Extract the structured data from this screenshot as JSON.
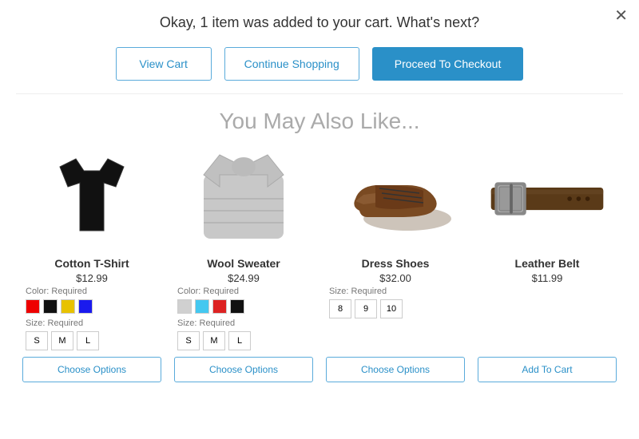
{
  "header": {
    "message": "Okay, 1 item was added to your cart. What's next?",
    "close_label": "✕"
  },
  "actions": {
    "view_cart": "View Cart",
    "continue_shopping": "Continue Shopping",
    "proceed_checkout": "Proceed To Checkout"
  },
  "section_title": "You May Also Like...",
  "products": [
    {
      "id": "tshirt",
      "name": "Cotton T-Shirt",
      "price": "$12.99",
      "color_label": "Color: Required",
      "colors": [
        "#e00",
        "#111",
        "#e8c200",
        "#1a1aee"
      ],
      "size_label": "Size: Required",
      "sizes": [
        "S",
        "M",
        "L"
      ],
      "cta": "Choose Options",
      "cta_type": "choose"
    },
    {
      "id": "sweater",
      "name": "Wool Sweater",
      "price": "$24.99",
      "color_label": "Color: Required",
      "colors": [
        "#d0d0d0",
        "#44c8f0",
        "#dd2222",
        "#111"
      ],
      "size_label": "Size: Required",
      "sizes": [
        "S",
        "M",
        "L"
      ],
      "cta": "Choose Options",
      "cta_type": "choose"
    },
    {
      "id": "shoes",
      "name": "Dress Shoes",
      "price": "$32.00",
      "color_label": null,
      "colors": [],
      "size_label": "Size: Required",
      "sizes": [
        "8",
        "9",
        "10"
      ],
      "cta": "Choose Options",
      "cta_type": "choose"
    },
    {
      "id": "belt",
      "name": "Leather Belt",
      "price": "$11.99",
      "color_label": null,
      "colors": [],
      "size_label": null,
      "sizes": [],
      "cta": "Add To Cart",
      "cta_type": "addcart"
    }
  ]
}
